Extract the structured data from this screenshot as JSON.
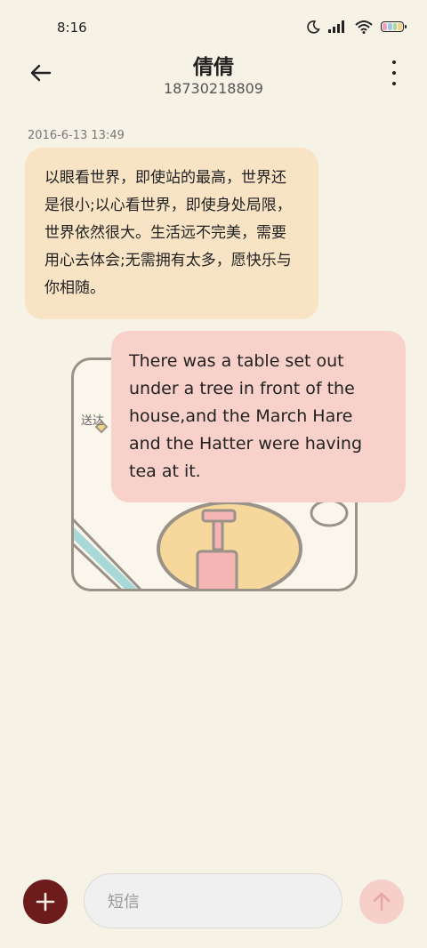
{
  "status_bar": {
    "time": "8:16",
    "battery_colors": [
      "#e9a3c8",
      "#9fc6e8",
      "#a8d8a0",
      "#f4d48a"
    ]
  },
  "header": {
    "contact_name": "倩倩",
    "contact_number": "18730218809"
  },
  "conversation": {
    "timestamp": "2016-6-13 13:49",
    "incoming_message": "以眼看世界，即使站的最高，世界还是很小;以心看世界，即使身处局限，世界依然很大。生活远不完美，需要用心去体会;无需拥有太多，愿快乐与你相随。",
    "sticker": {
      "label": "送达"
    },
    "outgoing_message": "There was a table set out under a tree in front of the house,and the March Hare and the Hatter were having tea at it."
  },
  "composer": {
    "placeholder": "短信"
  },
  "colors": {
    "background": "#f7f2e6",
    "incoming_bubble": "#f8e4c5",
    "outgoing_bubble": "#f8d2ca",
    "add_button": "#6e1b1b",
    "send_button": "#f6cfc9"
  }
}
